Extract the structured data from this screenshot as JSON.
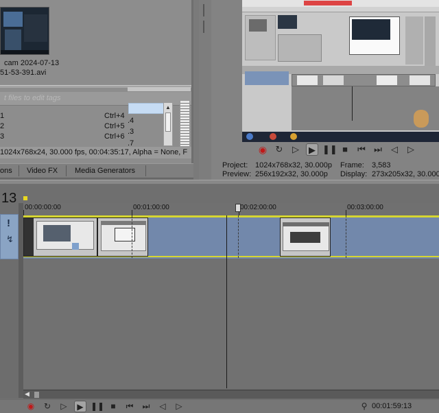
{
  "media": {
    "file_line1": "cam 2024-07-13",
    "file_line2": "51-53-391.avi",
    "filter_placeholder": "t files to edit tags",
    "shortcuts": [
      {
        "key": "1",
        "shortcut": "Ctrl+4"
      },
      {
        "key": "2",
        "shortcut": "Ctrl+5"
      },
      {
        "key": "3",
        "shortcut": "Ctrl+6"
      }
    ],
    "numbers": [
      ".4",
      ".3",
      ".7"
    ],
    "info": "1024x768x24, 30.000 fps, 00:04:35:17, Alpha = None, F"
  },
  "tabs": [
    "ons",
    "Video FX",
    "Media Generators"
  ],
  "preview": {
    "project_label": "Project:",
    "project_value": "1024x768x32, 30.000p",
    "preview_label": "Preview:",
    "preview_value": "256x192x32, 30.000p",
    "frame_label": "Frame:",
    "frame_value": "3,583",
    "display_label": "Display:",
    "display_value": "273x205x32, 30.000"
  },
  "timeline": {
    "timecode_fragment": "13",
    "ruler_labels": [
      "00:00:00:00",
      "00:01:00:00",
      "00:02:00:00",
      "00:03:00:00"
    ],
    "current_time": "00:01:59:13"
  },
  "icons": {
    "record": "record-icon",
    "loop": "loop-icon",
    "play_from_start": "play-from-start-icon",
    "play": "play-icon",
    "pause": "pause-icon",
    "stop": "stop-icon",
    "prev": "go-to-start-icon",
    "next": "go-to-end-icon",
    "prev_frame": "prev-frame-icon",
    "next_frame": "next-frame-icon"
  },
  "colors": {
    "track": "#7288ab",
    "track_edge": "#d6d630",
    "record_red": "#c01818",
    "selection": "#c6dcf4"
  }
}
